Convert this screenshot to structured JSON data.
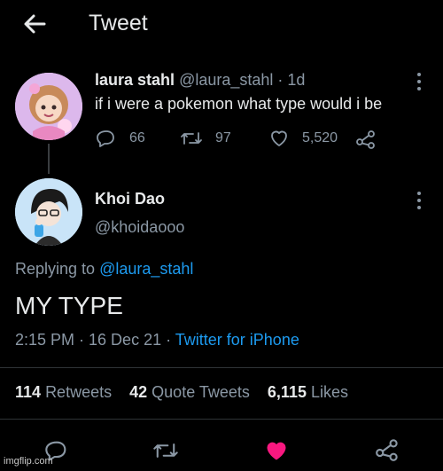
{
  "header": {
    "title": "Tweet"
  },
  "parent_tweet": {
    "display_name": "laura stahl",
    "handle": "@laura_stahl",
    "time": "· 1d",
    "text": "if i were a pokemon what type would i be",
    "replies": "66",
    "retweets": "97",
    "likes": "5,520"
  },
  "reply_tweet": {
    "display_name": "Khoi Dao",
    "handle": "@khoidaooo",
    "replying_label": "Replying to",
    "replying_to": "@laura_stahl",
    "text": "MY TYPE",
    "timestamp": "2:15 PM · 16 Dec 21 ·",
    "source": "Twitter for iPhone",
    "retweets_count": "114",
    "retweets_label": "Retweets",
    "quotes_count": "42",
    "quotes_label": "Quote Tweets",
    "likes_count": "6,115",
    "likes_label": "Likes"
  },
  "colors": {
    "accent": "#1d9bf0",
    "like": "#f91880",
    "muted": "#8b98a5"
  },
  "watermark": "imgflip.com"
}
